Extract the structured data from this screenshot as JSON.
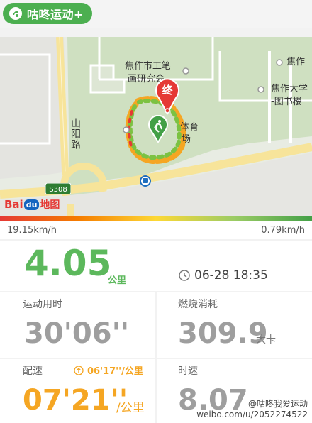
{
  "app": {
    "name": "咕咚运动+"
  },
  "map": {
    "labels": {
      "poi_1": "焦作市工笔",
      "poi_1b": "画研究会",
      "poi_2": "焦作",
      "poi_3": "焦作大学",
      "poi_3b": "-图书楼",
      "poi_4": "体育",
      "poi_4b": "场",
      "road": "山阳路",
      "shield": "S308"
    },
    "end_marker": "终",
    "provider": {
      "bai": "Bai",
      "du": "du",
      "suffix": "地图"
    }
  },
  "speed": {
    "max": "19.15km/h",
    "min": "0.79km/h"
  },
  "summary": {
    "distance": "4.05",
    "distance_unit": "公里",
    "datetime": "06-28 18:35"
  },
  "stats": {
    "duration_label": "运动用时",
    "duration_value": "30'06''",
    "calories_label": "燃烧消耗",
    "calories_value": "309.9",
    "calories_unit": "大卡",
    "pace_label": "配速",
    "best_pace": "06'17''/公里",
    "pace_value": "07'21''",
    "pace_unit": "/公里",
    "speed_label": "时速",
    "speed_value": "8.07"
  },
  "watermark": {
    "line1": "@咕咚我爱运动",
    "line2": "weibo.com/u/2052274522"
  },
  "colors": {
    "brand": "#4caf50",
    "distance": "#5cb85c",
    "pace": "#f5a623",
    "end_marker": "#e53935"
  }
}
